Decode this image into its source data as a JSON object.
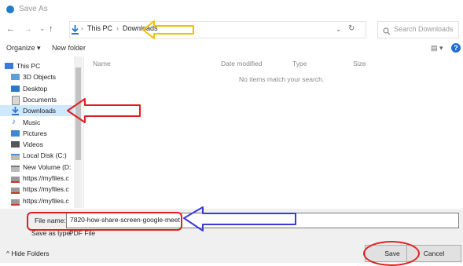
{
  "window": {
    "title": "Save As"
  },
  "address": {
    "back": "←",
    "forward": "→",
    "dropdown": "⌄",
    "up": "↑",
    "sep1": "›",
    "crumb1": "This PC",
    "sep2": "›",
    "crumb2": "Downloads",
    "refresh": "↻",
    "search_placeholder": "Search Downloads"
  },
  "toolbar": {
    "organize": "Organize ▾",
    "new_folder": "New folder",
    "view": "▤ ▾",
    "help": "?"
  },
  "nav": {
    "items": [
      {
        "label": "This PC",
        "icon": "pc-icon",
        "color": "#3a7bd5"
      },
      {
        "label": "3D Objects",
        "icon": "cube-icon",
        "color": "#5aa0e0"
      },
      {
        "label": "Desktop",
        "icon": "desktop-icon",
        "color": "#2b78d0"
      },
      {
        "label": "Documents",
        "icon": "documents-icon",
        "color": "#8a8a8a"
      },
      {
        "label": "Downloads",
        "icon": "downloads-icon",
        "color": "#2b78d0"
      },
      {
        "label": "Music",
        "icon": "music-icon",
        "color": "#1f6fd0"
      },
      {
        "label": "Pictures",
        "icon": "pictures-icon",
        "color": "#3b8ad8"
      },
      {
        "label": "Videos",
        "icon": "videos-icon",
        "color": "#555555"
      },
      {
        "label": "Local Disk (C:)",
        "icon": "disk-icon",
        "color": "#4a90d9"
      },
      {
        "label": "New Volume (D:",
        "icon": "disk-icon",
        "color": "#777777"
      },
      {
        "label": "https://myfiles.c",
        "icon": "network-drive-icon",
        "color": "#c0392b"
      },
      {
        "label": "https://myfiles.c",
        "icon": "network-drive-icon",
        "color": "#c0392b"
      },
      {
        "label": "https://myfiles.c",
        "icon": "network-drive-icon",
        "color": "#c0392b"
      }
    ]
  },
  "columns": {
    "name": "Name",
    "date": "Date modified",
    "type": "Type",
    "size": "Size"
  },
  "content": {
    "empty_message": "No items match your search."
  },
  "form": {
    "file_name_label": "File name:",
    "file_name_value": "7820-how-share-screen-google-meet",
    "save_as_type_label": "Save as type:",
    "save_as_type_value": "PDF File"
  },
  "footer": {
    "hide_folders": "^ Hide Folders",
    "save": "Save",
    "cancel": "Cancel"
  },
  "colors": {
    "selection": "#cde8ff",
    "annotation_red": "#e02020",
    "annotation_blue": "#3a3ad8",
    "annotation_yellow": "#f2c200"
  }
}
